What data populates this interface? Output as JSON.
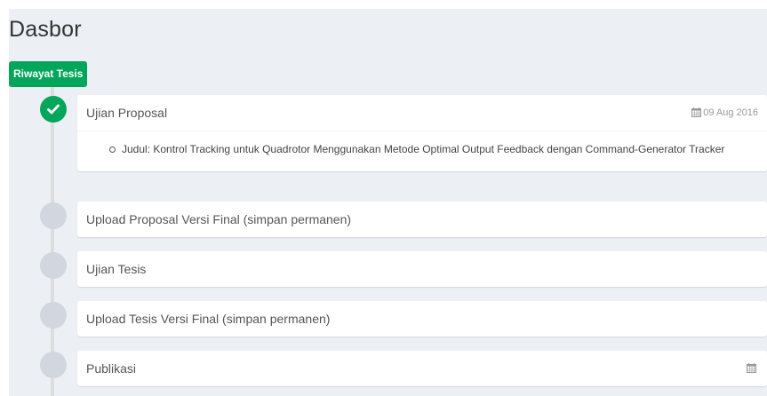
{
  "page": {
    "title": "Dasbor"
  },
  "section_badge": "Riwayat Tesis",
  "timeline": [
    {
      "title": "Ujian Proposal",
      "status": "done",
      "date": "09 Aug 2016",
      "details": [
        "Judul: Kontrol Tracking untuk Quadrotor Menggunakan Metode Optimal Output Feedback dengan Command-Generator Tracker"
      ]
    },
    {
      "title": "Upload Proposal Versi Final (simpan permanen)",
      "status": "pending"
    },
    {
      "title": "Ujian Tesis",
      "status": "pending"
    },
    {
      "title": "Upload Tesis Versi Final (simpan permanen)",
      "status": "pending"
    },
    {
      "title": "Publikasi",
      "status": "pending",
      "icon": "calendar-icon"
    }
  ],
  "colors": {
    "success": "#00a65a",
    "pending": "#d2d6de",
    "background": "#ecf0f5"
  }
}
